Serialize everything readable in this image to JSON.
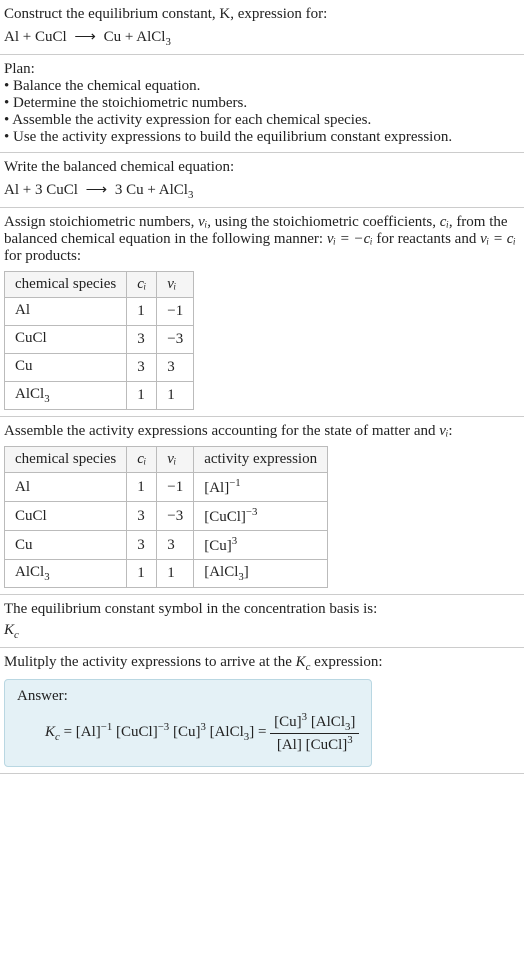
{
  "intro": {
    "line1": "Construct the equilibrium constant, K, expression for:",
    "eq_unbalanced_lhs": "Al + CuCl",
    "arrow": "⟶",
    "eq_unbalanced_rhs_a": "Cu + AlCl",
    "eq_unbalanced_rhs_sub": "3"
  },
  "plan": {
    "heading": "Plan:",
    "items": [
      "Balance the chemical equation.",
      "Determine the stoichiometric numbers.",
      "Assemble the activity expression for each chemical species.",
      "Use the activity expressions to build the equilibrium constant expression."
    ]
  },
  "balanced": {
    "heading": "Write the balanced chemical equation:",
    "lhs": "Al + 3 CuCl",
    "arrow": "⟶",
    "rhs_a": "3 Cu + AlCl",
    "rhs_sub": "3"
  },
  "stoich": {
    "text_a": "Assign stoichiometric numbers, ",
    "nu_i": "νᵢ",
    "text_b": ", using the stoichiometric coefficients, ",
    "c_i": "cᵢ",
    "text_c": ", from the balanced chemical equation in the following manner: ",
    "rule_react": "νᵢ = −cᵢ",
    "text_d": " for reactants and ",
    "rule_prod": "νᵢ = cᵢ",
    "text_e": " for products:",
    "headers": [
      "chemical species",
      "cᵢ",
      "νᵢ"
    ],
    "rows": [
      {
        "sp": "Al",
        "sp_sub": "",
        "c": "1",
        "v": "−1"
      },
      {
        "sp": "CuCl",
        "sp_sub": "",
        "c": "3",
        "v": "−3"
      },
      {
        "sp": "Cu",
        "sp_sub": "",
        "c": "3",
        "v": "3"
      },
      {
        "sp": "AlCl",
        "sp_sub": "3",
        "c": "1",
        "v": "1"
      }
    ]
  },
  "activity": {
    "heading_a": "Assemble the activity expressions accounting for the state of matter and ",
    "nu_i": "νᵢ",
    "heading_b": ":",
    "headers": [
      "chemical species",
      "cᵢ",
      "νᵢ",
      "activity expression"
    ],
    "rows": [
      {
        "sp": "Al",
        "sp_sub": "",
        "c": "1",
        "v": "−1",
        "act_base": "[Al]",
        "act_exp": "−1"
      },
      {
        "sp": "CuCl",
        "sp_sub": "",
        "c": "3",
        "v": "−3",
        "act_base": "[CuCl]",
        "act_exp": "−3"
      },
      {
        "sp": "Cu",
        "sp_sub": "",
        "c": "3",
        "v": "3",
        "act_base": "[Cu]",
        "act_exp": "3"
      },
      {
        "sp": "AlCl",
        "sp_sub": "3",
        "c": "1",
        "v": "1",
        "act_base": "[AlCl",
        "act_sub": "3",
        "act_after": "]",
        "act_exp": ""
      }
    ]
  },
  "symbol": {
    "text": "The equilibrium constant symbol in the concentration basis is:",
    "K": "K",
    "c": "c"
  },
  "final": {
    "heading": "Mulitply the activity expressions to arrive at the ",
    "K": "K",
    "c": "c",
    "heading_b": " expression:",
    "answer_label": "Answer:",
    "lhs_K": "K",
    "lhs_c": "c",
    "eq": " = ",
    "term1_base": "[Al]",
    "term1_exp": "−1",
    "term2_base": "[CuCl]",
    "term2_exp": "−3",
    "term3_base": "[Cu]",
    "term3_exp": "3",
    "term4_a": "[AlCl",
    "term4_sub": "3",
    "term4_b": "]",
    "eq2": " = ",
    "num_a": "[Cu]",
    "num_exp": "3",
    "num_b": " [AlCl",
    "num_sub": "3",
    "num_c": "]",
    "den_a": "[Al] [CuCl]",
    "den_exp": "3"
  },
  "chart_data": {
    "type": "table",
    "tables": [
      {
        "title": "Stoichiometric numbers",
        "columns": [
          "chemical species",
          "c_i",
          "nu_i"
        ],
        "rows": [
          [
            "Al",
            1,
            -1
          ],
          [
            "CuCl",
            3,
            -3
          ],
          [
            "Cu",
            3,
            3
          ],
          [
            "AlCl3",
            1,
            1
          ]
        ]
      },
      {
        "title": "Activity expressions",
        "columns": [
          "chemical species",
          "c_i",
          "nu_i",
          "activity expression"
        ],
        "rows": [
          [
            "Al",
            1,
            -1,
            "[Al]^-1"
          ],
          [
            "CuCl",
            3,
            -3,
            "[CuCl]^-3"
          ],
          [
            "Cu",
            3,
            3,
            "[Cu]^3"
          ],
          [
            "AlCl3",
            1,
            1,
            "[AlCl3]"
          ]
        ]
      }
    ]
  }
}
